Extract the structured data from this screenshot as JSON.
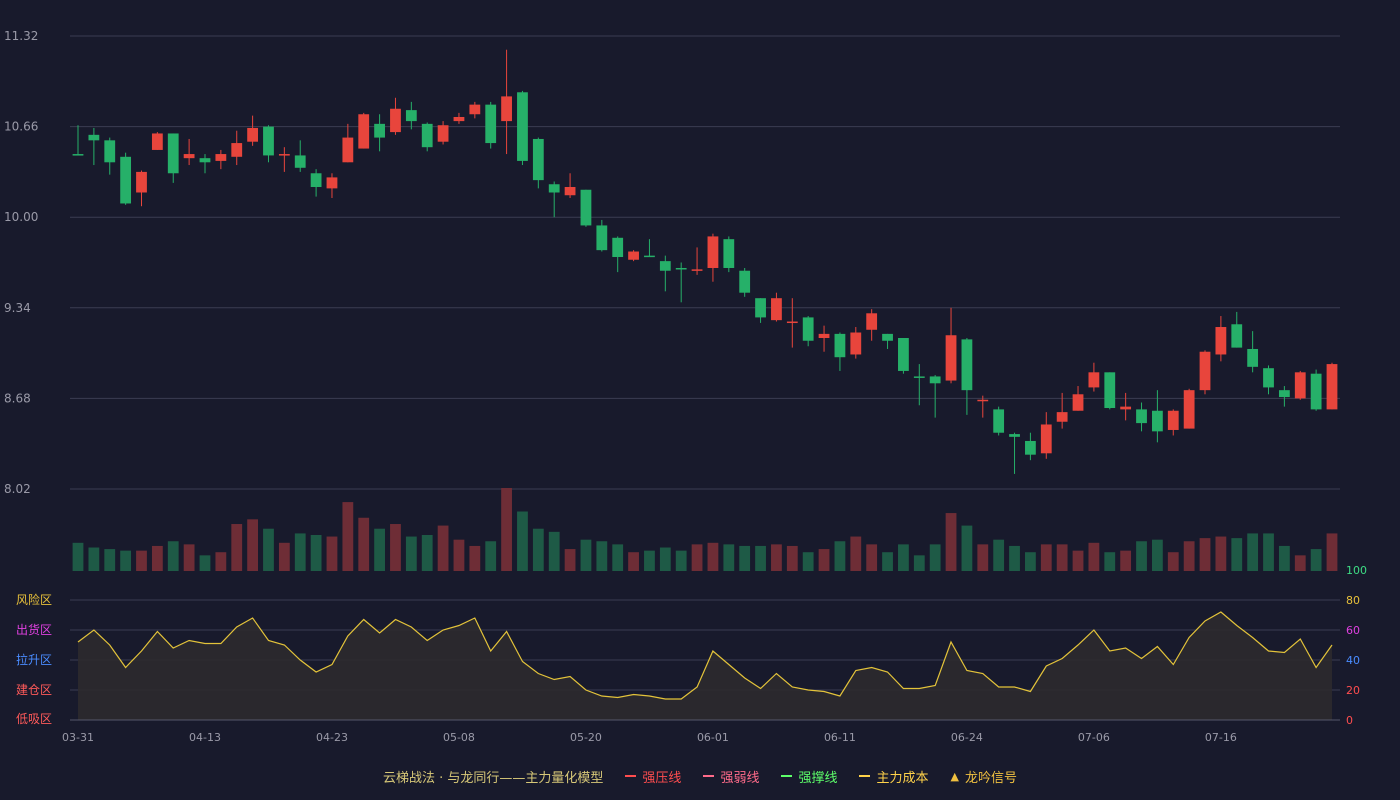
{
  "colors": {
    "up": "#e8453c",
    "down": "#26b069",
    "vol_up": "#6e2d36",
    "vol_down": "#1e5a46",
    "grid": "#3a3c52",
    "axis_text": "#9a9aa8",
    "osc_line": "#e3c33a",
    "osc_fill": "#2c2a2e"
  },
  "legend": {
    "title": "云梯战法 · 与龙同行——主力量化模型",
    "items": [
      {
        "label": "强压线",
        "color": "#ff4d4f",
        "style": "solid"
      },
      {
        "label": "强弱线",
        "color": "#ff6b8a",
        "style": "dash"
      },
      {
        "label": "强撑线",
        "color": "#5dff6a",
        "style": "solid"
      },
      {
        "label": "主力成本",
        "color": "#ffd24a",
        "style": "dash"
      },
      {
        "label": "龙吟信号",
        "color": "#f0c040",
        "style": "triangle"
      }
    ]
  },
  "chart_data": {
    "type": "candlestick",
    "price_axis": {
      "ticks": [
        "11.32",
        "10.66",
        "10.00",
        "9.34",
        "8.68",
        "8.02"
      ],
      "ylim": [
        8.02,
        11.32
      ]
    },
    "osc_axis": {
      "ticks": [
        0,
        20,
        40,
        60,
        80,
        100
      ],
      "ylim": [
        0,
        100
      ]
    },
    "zones": [
      {
        "label": "风险区",
        "color": "#e8c13a"
      },
      {
        "label": "出货区",
        "color": "#e040e0"
      },
      {
        "label": "拉升区",
        "color": "#4a8cff"
      },
      {
        "label": "建仓区",
        "color": "#ff5a5a"
      },
      {
        "label": "低吸区",
        "color": "#ff5a5a"
      }
    ],
    "x_labels": [
      {
        "index": 0,
        "label": "03-31"
      },
      {
        "index": 8,
        "label": "04-13"
      },
      {
        "index": 16,
        "label": "04-23"
      },
      {
        "index": 24,
        "label": "05-08"
      },
      {
        "index": 32,
        "label": "05-20"
      },
      {
        "index": 40,
        "label": "06-01"
      },
      {
        "index": 48,
        "label": "06-11"
      },
      {
        "index": 56,
        "label": "06-24"
      },
      {
        "index": 64,
        "label": "07-06"
      },
      {
        "index": 72,
        "label": "07-16"
      }
    ],
    "candles": [
      [
        10.46,
        10.45,
        10.67,
        10.45
      ],
      [
        10.6,
        10.56,
        10.65,
        10.38
      ],
      [
        10.56,
        10.4,
        10.58,
        10.31
      ],
      [
        10.44,
        10.1,
        10.47,
        10.09
      ],
      [
        10.18,
        10.33,
        10.34,
        10.08
      ],
      [
        10.49,
        10.61,
        10.62,
        10.49
      ],
      [
        10.61,
        10.32,
        10.61,
        10.25
      ],
      [
        10.43,
        10.46,
        10.57,
        10.38
      ],
      [
        10.43,
        10.4,
        10.46,
        10.32
      ],
      [
        10.41,
        10.46,
        10.49,
        10.35
      ],
      [
        10.44,
        10.54,
        10.63,
        10.38
      ],
      [
        10.55,
        10.65,
        10.74,
        10.52
      ],
      [
        10.66,
        10.45,
        10.67,
        10.4
      ],
      [
        10.46,
        10.46,
        10.51,
        10.33
      ],
      [
        10.45,
        10.36,
        10.56,
        10.33
      ],
      [
        10.32,
        10.22,
        10.35,
        10.15
      ],
      [
        10.21,
        10.29,
        10.32,
        10.14
      ],
      [
        10.4,
        10.58,
        10.68,
        10.4
      ],
      [
        10.5,
        10.75,
        10.76,
        10.5
      ],
      [
        10.68,
        10.58,
        10.75,
        10.48
      ],
      [
        10.62,
        10.79,
        10.87,
        10.6
      ],
      [
        10.78,
        10.7,
        10.84,
        10.64
      ],
      [
        10.68,
        10.51,
        10.69,
        10.48
      ],
      [
        10.55,
        10.67,
        10.7,
        10.53
      ],
      [
        10.7,
        10.73,
        10.76,
        10.68
      ],
      [
        10.75,
        10.82,
        10.84,
        10.72
      ],
      [
        10.82,
        10.54,
        10.84,
        10.5
      ],
      [
        10.7,
        10.88,
        11.22,
        10.46
      ],
      [
        10.91,
        10.41,
        10.92,
        10.38
      ],
      [
        10.57,
        10.27,
        10.58,
        10.21
      ],
      [
        10.24,
        10.18,
        10.26,
        10.0
      ],
      [
        10.16,
        10.22,
        10.32,
        10.14
      ],
      [
        10.2,
        9.94,
        10.2,
        9.93
      ],
      [
        9.94,
        9.76,
        9.98,
        9.75
      ],
      [
        9.85,
        9.71,
        9.86,
        9.6
      ],
      [
        9.69,
        9.75,
        9.76,
        9.68
      ],
      [
        9.72,
        9.71,
        9.84,
        9.71
      ],
      [
        9.68,
        9.61,
        9.72,
        9.46
      ],
      [
        9.63,
        9.62,
        9.67,
        9.38
      ],
      [
        9.61,
        9.62,
        9.78,
        9.58
      ],
      [
        9.63,
        9.86,
        9.88,
        9.53
      ],
      [
        9.84,
        9.63,
        9.86,
        9.6
      ],
      [
        9.61,
        9.45,
        9.63,
        9.42
      ],
      [
        9.41,
        9.27,
        9.41,
        9.23
      ],
      [
        9.25,
        9.41,
        9.45,
        9.24
      ],
      [
        9.24,
        9.24,
        9.41,
        9.05
      ],
      [
        9.27,
        9.1,
        9.28,
        9.06
      ],
      [
        9.12,
        9.15,
        9.21,
        9.02
      ],
      [
        9.15,
        8.98,
        9.16,
        8.88
      ],
      [
        9.0,
        9.16,
        9.2,
        8.97
      ],
      [
        9.18,
        9.3,
        9.33,
        9.1
      ],
      [
        9.15,
        9.1,
        9.15,
        9.04
      ],
      [
        9.12,
        8.88,
        9.12,
        8.86
      ],
      [
        8.84,
        8.83,
        8.93,
        8.63
      ],
      [
        8.84,
        8.79,
        8.85,
        8.54
      ],
      [
        8.81,
        9.14,
        9.34,
        8.79
      ],
      [
        9.11,
        8.74,
        9.12,
        8.56
      ],
      [
        8.67,
        8.67,
        8.7,
        8.54
      ],
      [
        8.6,
        8.43,
        8.62,
        8.41
      ],
      [
        8.42,
        8.4,
        8.43,
        8.13
      ],
      [
        8.37,
        8.27,
        8.43,
        8.23
      ],
      [
        8.28,
        8.49,
        8.58,
        8.24
      ],
      [
        8.51,
        8.58,
        8.72,
        8.46
      ],
      [
        8.59,
        8.71,
        8.77,
        8.59
      ],
      [
        8.76,
        8.87,
        8.94,
        8.73
      ],
      [
        8.87,
        8.61,
        8.87,
        8.6
      ],
      [
        8.6,
        8.62,
        8.72,
        8.52
      ],
      [
        8.6,
        8.5,
        8.65,
        8.44
      ],
      [
        8.59,
        8.44,
        8.74,
        8.36
      ],
      [
        8.45,
        8.59,
        8.6,
        8.41
      ],
      [
        8.46,
        8.74,
        8.75,
        8.46
      ],
      [
        8.74,
        9.02,
        9.03,
        8.71
      ],
      [
        9.0,
        9.2,
        9.28,
        8.95
      ],
      [
        9.22,
        9.05,
        9.31,
        9.05
      ],
      [
        9.04,
        8.91,
        9.17,
        8.87
      ],
      [
        8.9,
        8.76,
        8.92,
        8.71
      ],
      [
        8.74,
        8.69,
        8.77,
        8.62
      ],
      [
        8.68,
        8.87,
        8.88,
        8.67
      ],
      [
        8.86,
        8.6,
        8.89,
        8.59
      ],
      [
        8.6,
        8.93,
        8.94,
        8.6
      ]
    ],
    "volume": [
      18,
      15,
      14,
      13,
      13,
      16,
      19,
      17,
      10,
      12,
      30,
      33,
      27,
      18,
      24,
      23,
      22,
      44,
      34,
      27,
      30,
      22,
      23,
      29,
      20,
      16,
      19,
      53,
      38,
      27,
      25,
      14,
      20,
      19,
      17,
      12,
      13,
      15,
      13,
      17,
      18,
      17,
      16,
      16,
      17,
      16,
      12,
      14,
      19,
      22,
      17,
      12,
      17,
      10,
      17,
      37,
      29,
      17,
      20,
      16,
      12,
      17,
      17,
      13,
      18,
      12,
      13,
      19,
      20,
      12,
      19,
      21,
      22,
      21,
      24,
      24,
      16,
      10,
      14,
      24
    ],
    "oscillator": [
      52,
      60,
      50,
      35,
      46,
      59,
      48,
      53,
      51,
      51,
      62,
      68,
      53,
      50,
      40,
      32,
      37,
      56,
      67,
      58,
      67,
      62,
      53,
      60,
      63,
      68,
      46,
      59,
      39,
      31,
      27,
      29,
      20,
      16,
      15,
      17,
      16,
      14,
      14,
      22,
      46,
      37,
      28,
      21,
      31,
      22,
      20,
      19,
      16,
      33,
      35,
      32,
      21,
      21,
      23,
      52,
      33,
      31,
      22,
      22,
      19,
      36,
      41,
      50,
      60,
      46,
      48,
      41,
      49,
      37,
      55,
      66,
      72,
      63,
      55,
      46,
      45,
      54,
      35,
      50
    ]
  }
}
